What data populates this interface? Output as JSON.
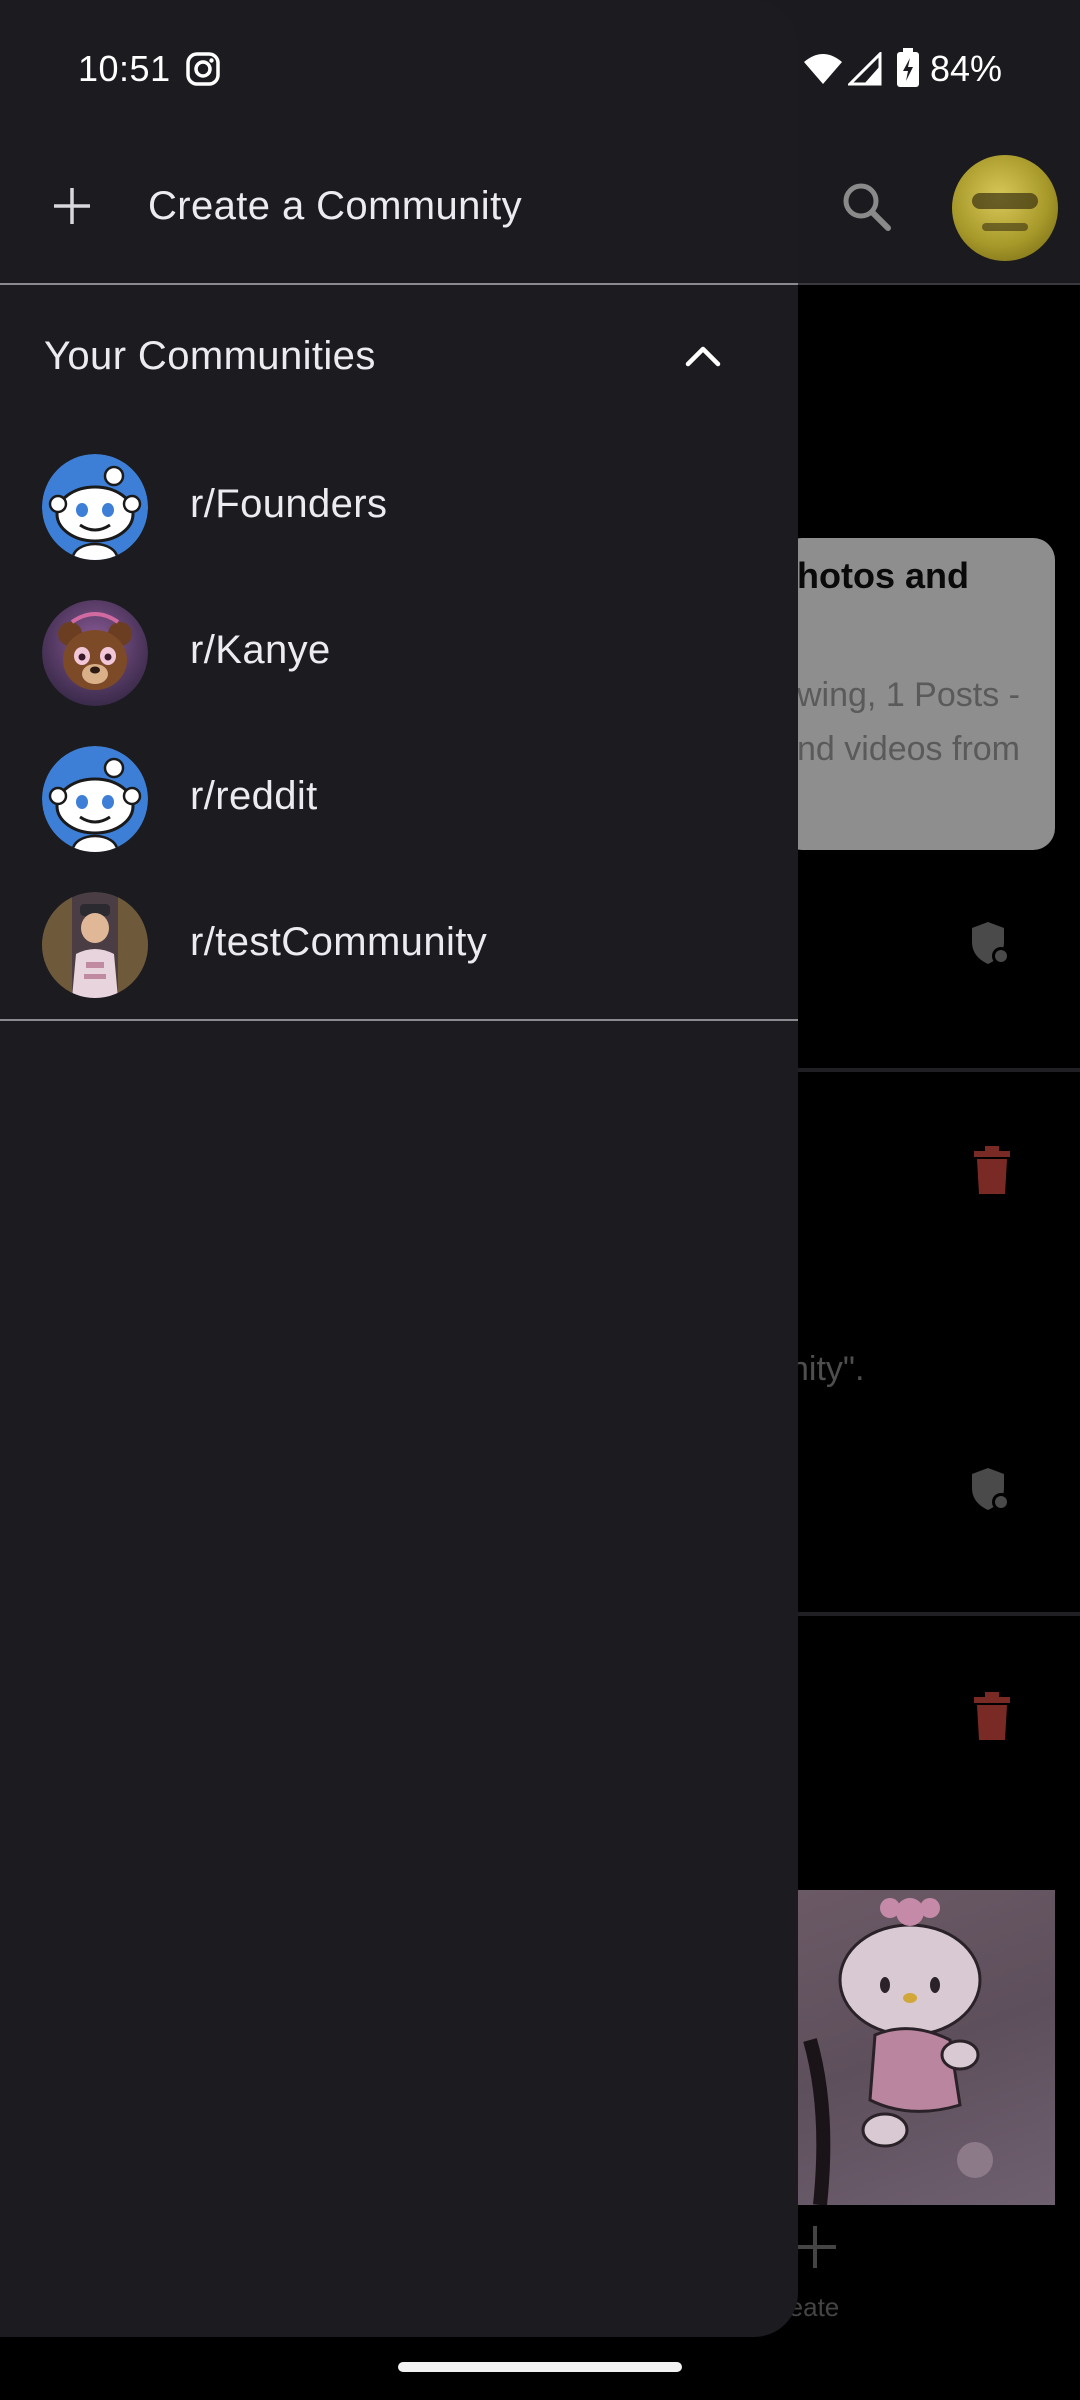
{
  "status_bar": {
    "time": "10:51",
    "battery": "84%",
    "icons": [
      "instagram-icon",
      "wifi-icon",
      "cellular-signal-icon",
      "battery-charging-icon"
    ]
  },
  "drawer": {
    "create_label": "Create a Community",
    "section_title": "Your Communities",
    "communities": [
      {
        "label": "r/Founders",
        "avatar": "reddit-snoo"
      },
      {
        "label": "r/Kanye",
        "avatar": "bear-photo"
      },
      {
        "label": "r/reddit",
        "avatar": "reddit-snoo"
      },
      {
        "label": "r/testCommunity",
        "avatar": "person-photo"
      }
    ]
  },
  "background": {
    "card_title": "hotos and",
    "card_line1": "wing, 1 Posts -",
    "card_line2": "nd videos from",
    "post_text": "nity\".",
    "create_label": "reate"
  },
  "colors": {
    "drawer_bg": "#1c1b20",
    "snoo_blue": "#3d7fd6",
    "trash_red": "#8a2c25",
    "divider": "#8a8a90"
  }
}
